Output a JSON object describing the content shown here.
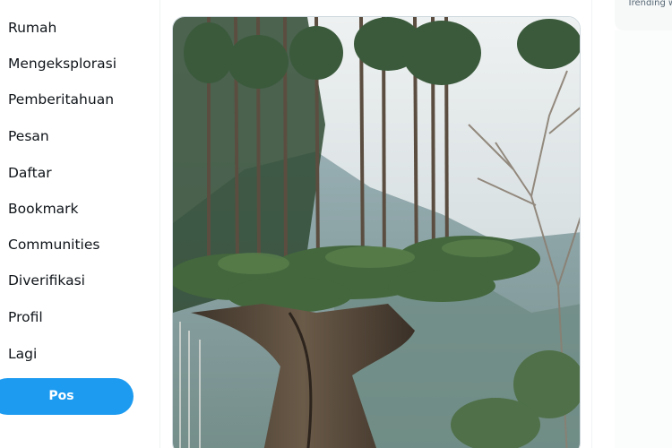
{
  "nav": {
    "items": [
      {
        "label": "Rumah",
        "icon": "home-icon"
      },
      {
        "label": "Mengeksplorasi",
        "icon": "explore-icon"
      },
      {
        "label": "Pemberitahuan",
        "icon": "notifications-icon"
      },
      {
        "label": "Pesan",
        "icon": "messages-icon"
      },
      {
        "label": "Daftar",
        "icon": "lists-icon"
      },
      {
        "label": "Bookmark",
        "icon": "bookmark-icon"
      },
      {
        "label": "Communities",
        "icon": "communities-icon"
      },
      {
        "label": "Diverifikasi",
        "icon": "verified-icon"
      },
      {
        "label": "Profil",
        "icon": "profile-icon"
      },
      {
        "label": "Lagi",
        "icon": "more-icon"
      }
    ],
    "post_label": "Pos"
  },
  "right": {
    "trending_text": "Trending w"
  },
  "colors": {
    "accent": "#1d9bf0",
    "text": "#0f1419",
    "divider": "#eff3f4"
  }
}
